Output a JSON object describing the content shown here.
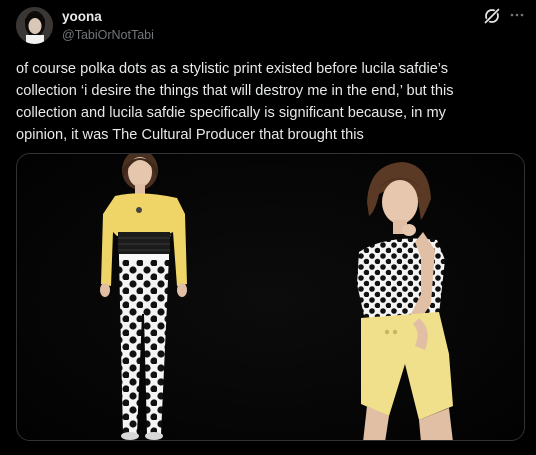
{
  "author": {
    "display_name": "yoona",
    "handle": "@TabiOrNotTabi"
  },
  "actions": {
    "grok_icon": "grok-icon",
    "more_icon": "more-icon"
  },
  "tweet": {
    "text": "of course polka dots as a stylistic print existed before lucila safdie’s\ncollection ‘i desire the things that will destroy me in the end,’ but this\ncollection and lucila safdie specifically is significant because, in my\nopinion, it was The Cultural Producer that brought this"
  },
  "colors": {
    "background": "#000000",
    "text": "#e7e9ea",
    "secondary_text": "#71767b",
    "border": "#2f3336"
  }
}
